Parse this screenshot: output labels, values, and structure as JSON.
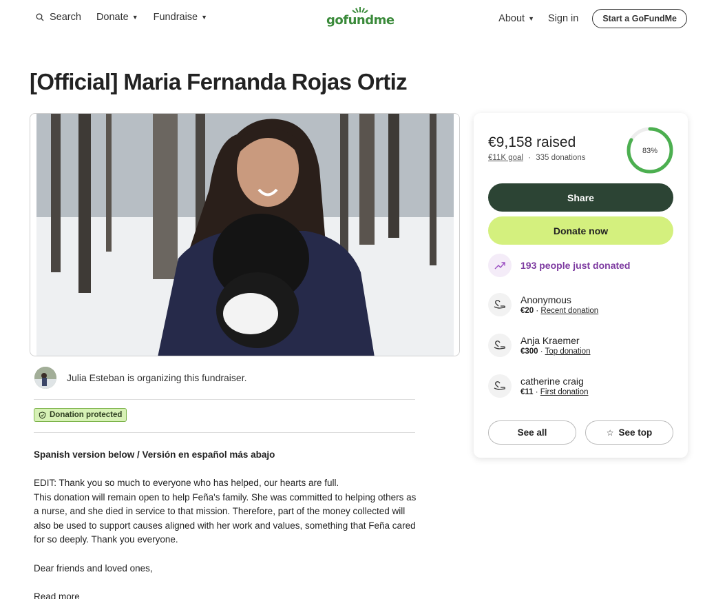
{
  "nav": {
    "search_label": "Search",
    "donate_label": "Donate",
    "fundraise_label": "Fundraise",
    "logo_text": "gofundme",
    "about_label": "About",
    "signin_label": "Sign in",
    "start_label": "Start a GoFundMe"
  },
  "page": {
    "title": "[Official] Maria Fernanda Rojas Ortiz"
  },
  "organizer": {
    "text": "Julia Esteban is organizing this fundraiser."
  },
  "badge": {
    "protected_label": "Donation protected"
  },
  "story": {
    "heading": "Spanish version below / Versión en español más abajo",
    "paragraph_1": "EDIT: Thank you so much to everyone who has helped, our hearts are full.\nThis donation will remain open to help Feña's family. She was committed to helping others as a nurse, and she died in service to that mission. Therefore, part of the money collected will also be used to support causes aligned with her work and values, something that Feña cared for so deeply. Thank you everyone.",
    "paragraph_2": "Dear friends and loved ones,",
    "read_more": "Read more"
  },
  "sidebar": {
    "raised": "€9,158 raised",
    "goal": "€11K goal",
    "separator": "·",
    "donations": "335 donations",
    "progress_percent": 83,
    "progress_label": "83%",
    "share_label": "Share",
    "donate_label": "Donate now",
    "trend_text": "193 people just donated",
    "donors": [
      {
        "name": "Anonymous",
        "amount": "€20",
        "tag": "Recent donation"
      },
      {
        "name": "Anja Kraemer",
        "amount": "€300",
        "tag": "Top donation"
      },
      {
        "name": "catherine craig",
        "amount": "€11",
        "tag": "First donation"
      }
    ],
    "see_all_label": "See all",
    "see_top_label": "See top"
  },
  "colors": {
    "brand_green": "#3a8a3a",
    "share_button": "#2c4434",
    "donate_button": "#d4f07e",
    "progress_ring": "#4caf50",
    "trend_purple": "#7d3aa0"
  }
}
